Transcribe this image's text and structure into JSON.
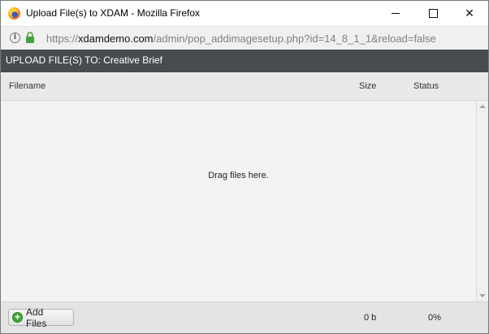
{
  "window": {
    "title": "Upload File(s) to XDAM - Mozilla Firefox",
    "app_icon": "firefox-icon",
    "controls": {
      "minimize": "minimize-icon",
      "maximize": "maximize-icon",
      "close": "close-icon",
      "close_glyph": "✕"
    }
  },
  "urlbar": {
    "info_glyph": "i",
    "scheme": "https://",
    "domain": "xdamdemo.com",
    "path": "/admin/pop_addimagesetup.php?id=14_8_1_1&reload=false",
    "lock_color": "#44a33a"
  },
  "upload": {
    "header": "UPLOAD FILE(S) TO: Creative Brief",
    "columns": {
      "filename": "Filename",
      "size": "Size",
      "status": "Status"
    },
    "files": [],
    "drop_hint": "Drag files here.",
    "add_files_label": "Add Files",
    "add_icon_glyph": "+",
    "total_size": "0 b",
    "total_status": "0%"
  },
  "colors": {
    "header_bg": "#484c50",
    "add_icon": "#42a53a"
  }
}
